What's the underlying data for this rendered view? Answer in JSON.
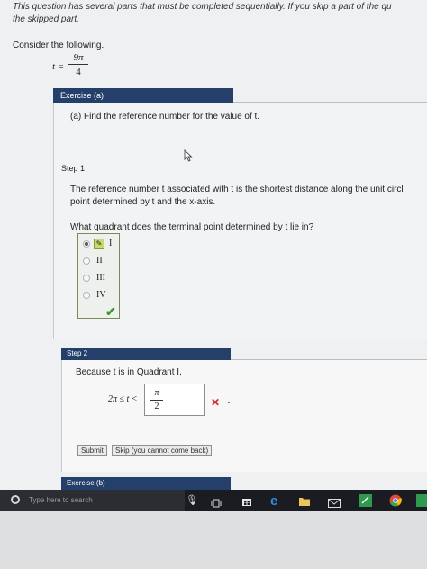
{
  "notice_line1": "This question has several parts that must be completed sequentially. If you skip a part of the qu",
  "notice_line2": "the skipped part.",
  "prompt": "Consider the following.",
  "given": {
    "var": "t =",
    "numerator": "9π",
    "denominator": "4"
  },
  "exercise_a": {
    "title": "Exercise (a)",
    "question": "(a) Find the reference number for the value of t."
  },
  "step1": {
    "title": "Step 1",
    "text_line1": "The reference number t̄ associated with t is the shortest distance along the unit circl",
    "text_line2": "point determined by t and the x-axis.",
    "question": "What quadrant does the terminal point determined by t lie in?",
    "options": [
      "I",
      "II",
      "III",
      "IV"
    ],
    "selected": "I"
  },
  "step2": {
    "title": "Step 2",
    "text": "Because t is in Quadrant I,",
    "inequality_left": "2π ≤ t <",
    "answer_numerator": "π",
    "answer_denominator": "2",
    "submit_label": "Submit",
    "skip_label": "Skip (you cannot come back)"
  },
  "exercise_b": {
    "title": "Exercise (b)"
  },
  "taskbar": {
    "search_placeholder": "Type here to search"
  }
}
